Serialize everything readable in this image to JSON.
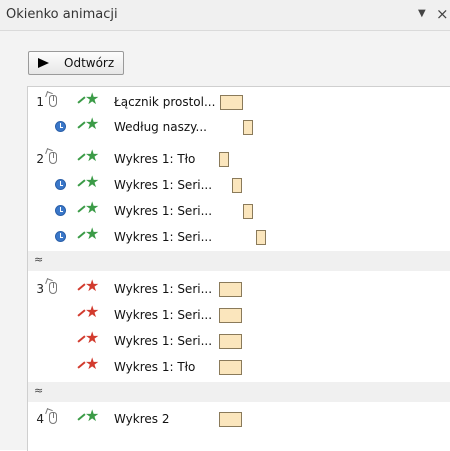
{
  "pane": {
    "title": "Okienko animacji",
    "menu_arrow": "▼",
    "close_label": "×"
  },
  "play_button": {
    "label": "Odtwórz"
  },
  "groups": [
    {
      "number": "1",
      "items": [
        {
          "label": "Łącznik prostol...",
          "trigger": "click",
          "effect": "entrance",
          "bar_start": 0.0,
          "bar_width": 0.25
        },
        {
          "label": "Według naszy...",
          "trigger": "after",
          "effect": "entrance",
          "bar_start": 0.25,
          "bar_width": 0.08
        }
      ]
    },
    {
      "number": "2",
      "items": [
        {
          "label": "Wykres 1: Tło",
          "trigger": "click",
          "effect": "entrance"
        },
        {
          "label": "Wykres 1: Seri...",
          "trigger": "after",
          "effect": "entrance"
        },
        {
          "label": "Wykres 1: Seri...",
          "trigger": "after",
          "effect": "entrance"
        },
        {
          "label": "Wykres 1: Seri...",
          "trigger": "after",
          "effect": "entrance"
        }
      ]
    },
    {
      "number": "3",
      "items": [
        {
          "label": "Wykres 1: Seri...",
          "trigger": "click",
          "effect": "exit"
        },
        {
          "label": "Wykres 1: Seri...",
          "trigger": "with",
          "effect": "exit"
        },
        {
          "label": "Wykres 1: Seri...",
          "trigger": "with",
          "effect": "exit"
        },
        {
          "label": "Wykres 1: Tło",
          "trigger": "with",
          "effect": "exit"
        }
      ]
    },
    {
      "number": "4",
      "items": [
        {
          "label": "Wykres 2",
          "trigger": "click",
          "effect": "entrance"
        }
      ]
    }
  ],
  "collapse_glyph": "»",
  "colors": {
    "entrance": "#3b9b47",
    "exit": "#d23b2e",
    "timing_bar": "#fbe6bd",
    "clock": "#3a77c9"
  }
}
